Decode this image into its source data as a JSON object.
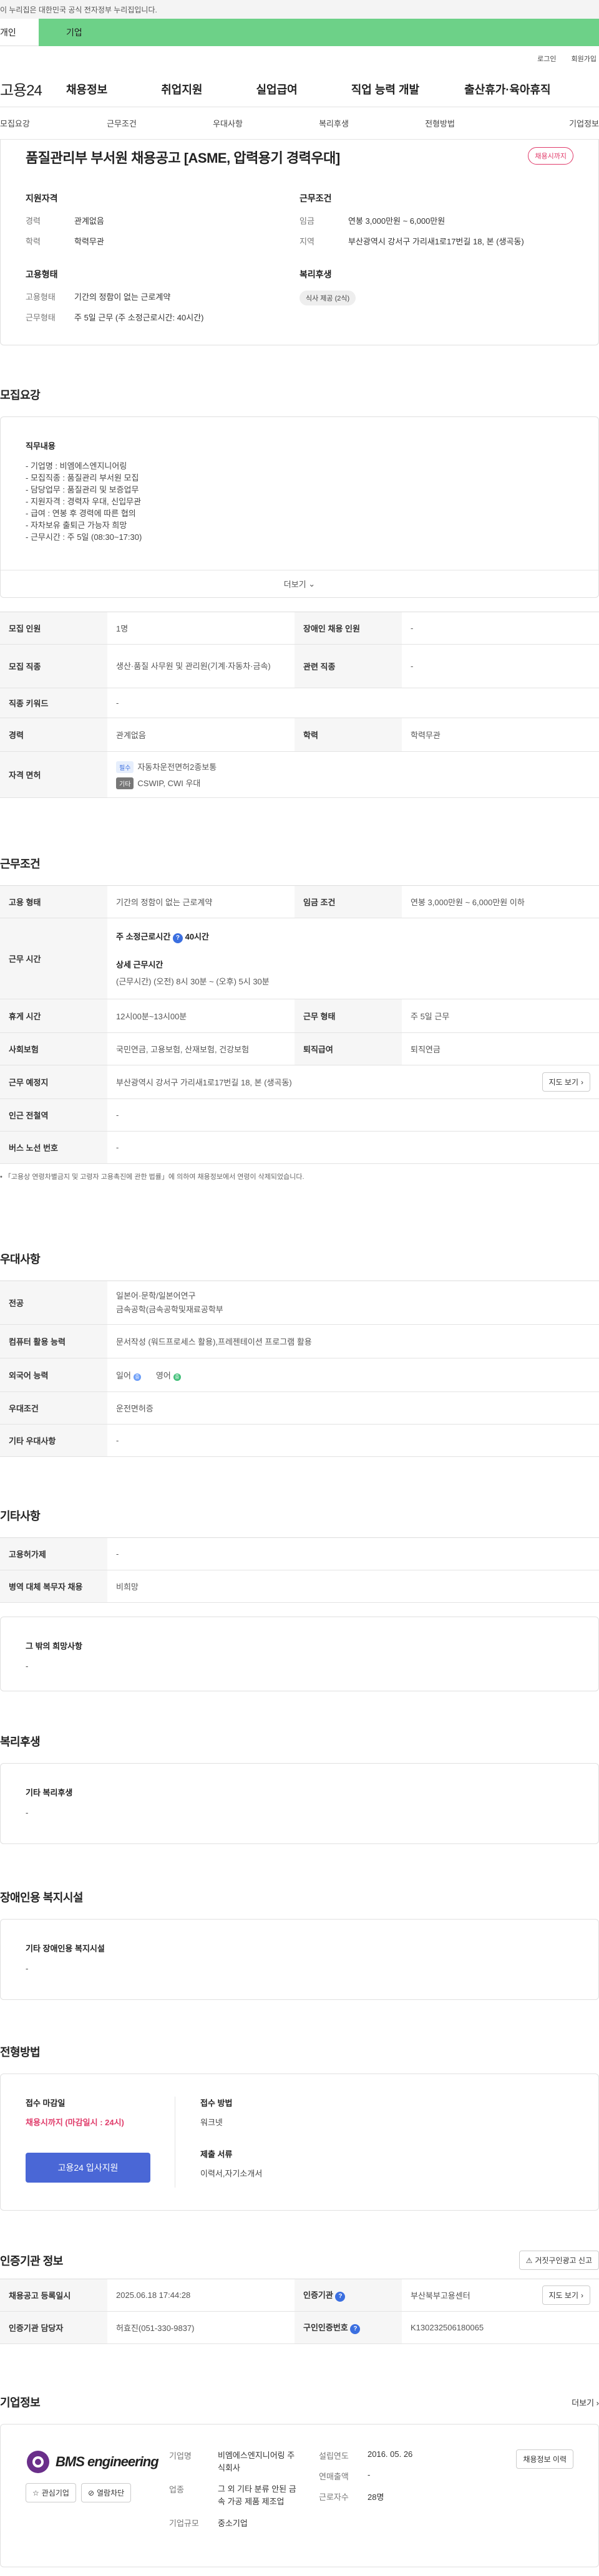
{
  "gov_banner": "이 누리집은 대한민국 공식 전자정부 누리집입니다.",
  "user_tabs": [
    "개인",
    "기업"
  ],
  "top_links": [
    "로그인",
    "회원가입"
  ],
  "logo": "고용24",
  "gnb": [
    "채용정보",
    "취업지원",
    "실업급여",
    "직업 능력 개발",
    "출산휴가·육아휴직"
  ],
  "subnav": [
    "모집요강",
    "근무조건",
    "우대사항",
    "복리후생",
    "전형방법",
    "기업정보"
  ],
  "job": {
    "title": "품질관리부 부서원 채용공고 [ASME, 압력용기 경력우대]",
    "status": "채용시까지",
    "qual_h": "지원자격",
    "qual": [
      [
        "경력",
        "관계없음"
      ],
      [
        "학력",
        "학력무관"
      ]
    ],
    "emp_h": "고용형태",
    "emp": [
      [
        "고용형태",
        "기간의 정함이 없는 근로계약"
      ],
      [
        "근무형태",
        "주 5일 근무 (주 소정근로시간: 40시간)"
      ]
    ],
    "cond_h": "근무조건",
    "cond": [
      [
        "임금",
        "연봉 3,000만원 ~ 6,000만원"
      ],
      [
        "지역",
        "부산광역시 강서구 가리새1로17번길 18, 본 (생곡동)"
      ]
    ],
    "welfare_h": "복리후생",
    "welfare_chip": "식사 제공 (2식)"
  },
  "recruit": {
    "title": "모집요강",
    "duty_h": "직무내용",
    "duty": "- 기업명 : 비엠에스엔지니어링\n- 모집직종 : 품질관리 부서원 모집\n- 담당업무 : 품질관리 및 보증업무\n- 지원자격 : 경력자 우대, 신입무관\n- 급여 : 연봉 후 경력에 따른 협의\n- 자차보유 출퇴근 가능자 희망\n- 근무시간 : 주 5일 (08:30~17:30)",
    "more": "더보기",
    "rows": {
      "count_h": "모집 인원",
      "count": "1명",
      "dis_h": "장애인 채용 인원",
      "dis": "-",
      "job_h": "모집 직종",
      "job": "생산·품질 사무원 및 관리원(기계·자동차·금속)",
      "rel_h": "관련 직종",
      "rel": "-",
      "kw_h": "직종 키워드",
      "kw": "-",
      "career_h": "경력",
      "career": "관계없음",
      "edu_h": "학력",
      "edu": "학력무관",
      "lic_h": "자격 면허",
      "lic_tag1": "필수",
      "lic1": "자동차운전면허2종보통",
      "lic_tag2": "기타",
      "lic2": "CSWIP, CWI 우대"
    }
  },
  "work": {
    "title": "근무조건",
    "type_h": "고용 형태",
    "type": "기간의 정함이 없는 근로계약",
    "wage_h": "임금 조건",
    "wage": "연봉 3,000만원 ~ 6,000만원 이하",
    "time_h": "근무 시간",
    "time1_label": "주 소정근로시간",
    "time1": "40시간",
    "time2_h": "상세 근무시간",
    "time2": "(근무시간) (오전) 8시 30분 ~ (오후) 5시 30분",
    "rest_h": "휴게 시간",
    "rest": "12시00분~13시00분",
    "form_h": "근무 형태",
    "form": "주 5일 근무",
    "ins_h": "사회보험",
    "ins": "국민연금, 고용보험, 산재보험, 건강보험",
    "ret_h": "퇴직급여",
    "ret": "퇴직연금",
    "place_h": "근무 예정지",
    "place": "부산광역시 강서구 가리새1로17번길 18, 본 (생곡동)",
    "map": "지도 보기",
    "sub_h": "인근 전철역",
    "sub": "-",
    "bus_h": "버스 노선 번호",
    "bus": "-",
    "note": "「고용상 연령차별금지 및 고령자 고용촉진에 관한 법률」에 의하여 채용정보에서 연령이 삭제되었습니다."
  },
  "pref": {
    "title": "우대사항",
    "major_h": "전공",
    "major1": "일본어·문학/일본어연구",
    "major2": "금속공학(금속공학및재료공학부",
    "pc_h": "컴퓨터 활용 능력",
    "pc": "문서작성 (워드프로세스 활용),프레젠테이션 프로그램 활용",
    "lang_h": "외국어 능력",
    "lang1": "일어",
    "lang1_lv": "중",
    "lang2": "영어",
    "lang2_lv": "중",
    "cond_h": "우대조건",
    "cond": "운전면허증",
    "etc_h": "기타 우대사항",
    "etc": "-"
  },
  "other": {
    "title": "기타사항",
    "emp_h": "고용허가제",
    "emp": "-",
    "mil_h": "병역 대체 복무자 채용",
    "mil": "비희망",
    "hope_h": "그 밖의 희망사항",
    "hope": "-"
  },
  "welfare": {
    "title": "복리후생",
    "etc_h": "기타 복리후생",
    "etc": "-"
  },
  "dis": {
    "title": "장애인용 복지시설",
    "etc_h": "기타 장애인용 복지시설",
    "etc": "-"
  },
  "process": {
    "title": "전형방법",
    "dl_h": "접수 마감일",
    "dl": "채용시까지 (마감일시 : 24시)",
    "apply": "고용24 입사지원",
    "method_h": "접수 방법",
    "method": "워크넷",
    "docs_h": "제출 서류",
    "docs": "이력서,자기소개서"
  },
  "agency": {
    "title": "인증기관 정보",
    "report": "거짓구인광고 신고",
    "reg_h": "채용공고 등록일시",
    "reg": "2025.06.18 17:44:28",
    "org_h": "인증기관",
    "org": "부산북부고용센터",
    "map": "지도 보기",
    "mgr_h": "인증기관 담당자",
    "mgr": "허효진(051-330-9837)",
    "no_h": "구인인증번호",
    "no": "K130232506180065"
  },
  "company": {
    "title": "기업정보",
    "more": "더보기",
    "logo": "BMS engineering",
    "fav": "관심기업",
    "block": "열람차단",
    "name_h": "기업명",
    "name": "비엠에스엔지니어링 주식회사",
    "biz_h": "업종",
    "biz": "그 외 기타 분류 안된 금속 가공 제품 제조업",
    "size_h": "기업규모",
    "size": "중소기업",
    "est_h": "설립연도",
    "est": "2016. 05. 26",
    "sales_h": "연매출액",
    "sales": "-",
    "emp_h": "근로자수",
    "emp": "28명",
    "jobs": "채용정보 이력"
  }
}
